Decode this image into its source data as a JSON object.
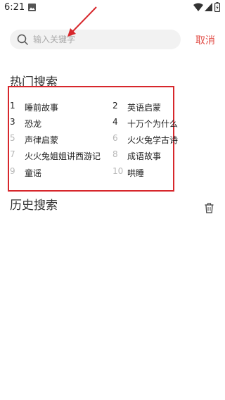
{
  "status_bar": {
    "time": "6:21"
  },
  "search": {
    "placeholder": "输入关键字",
    "value": ""
  },
  "cancel_label": "取消",
  "hot_search": {
    "title": "热门搜索",
    "items": [
      {
        "rank": "1",
        "label": "睡前故事"
      },
      {
        "rank": "2",
        "label": "英语启蒙"
      },
      {
        "rank": "3",
        "label": "恐龙"
      },
      {
        "rank": "4",
        "label": "十万个为什么"
      },
      {
        "rank": "5",
        "label": "声律启蒙"
      },
      {
        "rank": "6",
        "label": "火火兔学古诗"
      },
      {
        "rank": "7",
        "label": "火火兔姐姐讲西游记"
      },
      {
        "rank": "8",
        "label": "成语故事"
      },
      {
        "rank": "9",
        "label": "童谣"
      },
      {
        "rank": "10",
        "label": "哄睡"
      }
    ]
  },
  "history_search": {
    "title": "历史搜索"
  },
  "colors": {
    "accent": "#e2504a",
    "highlight_frame": "#d7272c",
    "rank_muted": "#b8b8b8"
  }
}
